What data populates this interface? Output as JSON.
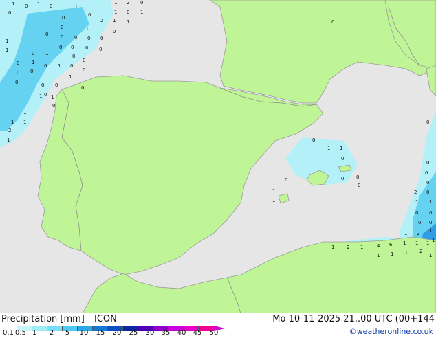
{
  "footer": {
    "title": "Precipitation [mm]",
    "model": "ICON",
    "datetime": "Mo 10-11-2025 21..00 UTC (00+144",
    "credit": "©weatheronline.co.uk"
  },
  "colors": {
    "sea": "#e6e6e6",
    "land": "#bff596",
    "border": "#9a9a9a",
    "precip_light": "#b4f0f8",
    "precip_medium": "#64d2f0",
    "precip_heavy": "#2f9ce6"
  },
  "legend": {
    "labels": [
      "0.1",
      "0.5",
      "1",
      "2",
      "5",
      "10",
      "15",
      "20",
      "25",
      "30",
      "35",
      "40",
      "45",
      "50"
    ],
    "colors": [
      "#ffffff",
      "#c8f5fa",
      "#a0ebf8",
      "#78def5",
      "#50c8f0",
      "#28aae6",
      "#1478d2",
      "#0a50be",
      "#0a28a0",
      "#5000b4",
      "#8c00c8",
      "#c800dc",
      "#e600c8",
      "#f00096"
    ]
  },
  "precip_values": [
    "1",
    "0",
    "1",
    "0",
    "0",
    "1",
    "2",
    "0",
    "0",
    "0",
    "0",
    "1",
    "0",
    "1",
    "0",
    "0",
    "2",
    "1",
    "1",
    "0",
    "0",
    "0",
    "0",
    "0",
    "0",
    "1",
    "1",
    "0",
    "1",
    "0",
    "0",
    "0",
    "0",
    "0",
    "0",
    "1",
    "0",
    "1",
    "0",
    "0",
    "0",
    "0",
    "0",
    "0",
    "1",
    "0",
    "0",
    "0",
    "0",
    "1",
    "1",
    "0",
    "1",
    "1",
    "1",
    "2",
    "1",
    "0",
    "0",
    "1",
    "1",
    "0",
    "0",
    "0",
    "0",
    "0",
    "0",
    "0",
    "0",
    "1",
    "1",
    "0",
    "2",
    "0",
    "1",
    "1",
    "0",
    "0",
    "0",
    "0",
    "1",
    "2",
    "1",
    "1",
    "1",
    "1",
    "1",
    "1",
    "2",
    "1",
    "4",
    "6",
    "1",
    "1",
    "1",
    "0",
    "2",
    "0",
    "1",
    "0",
    "1",
    "2",
    "0",
    "1"
  ]
}
